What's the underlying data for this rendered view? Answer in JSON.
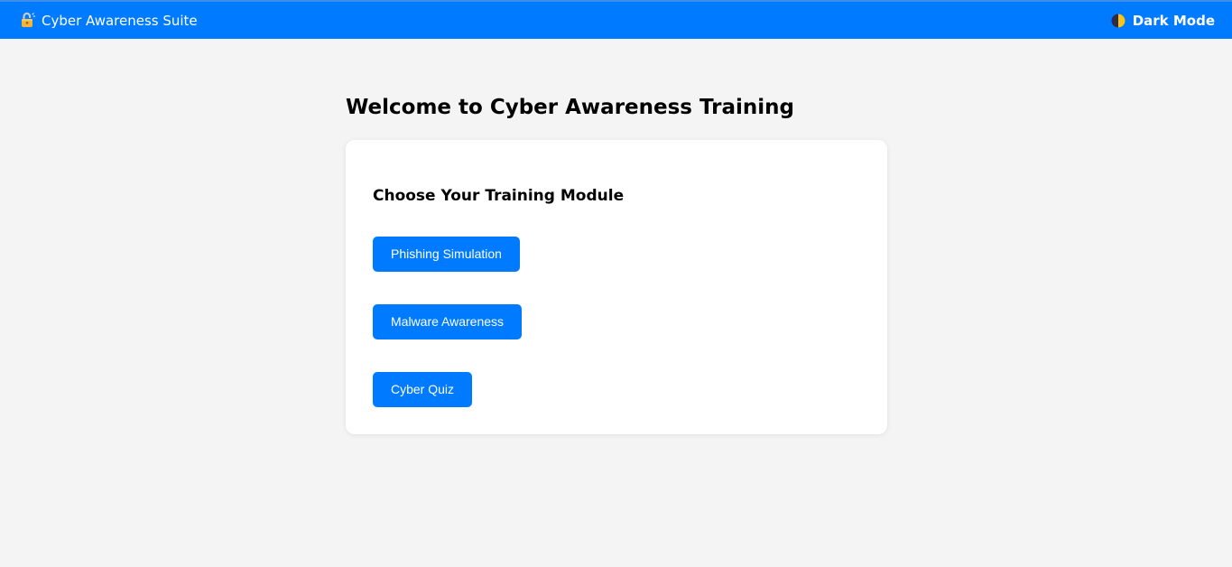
{
  "header": {
    "brand_icon": "lock-icon",
    "brand_title": "Cyber Awareness Suite",
    "dark_mode_icon": "contrast-icon",
    "dark_mode_label": "Dark Mode",
    "accent_color": "#007bff"
  },
  "main": {
    "title": "Welcome to Cyber Awareness Training",
    "card": {
      "heading": "Choose Your Training Module",
      "modules": [
        {
          "label": "Phishing Simulation"
        },
        {
          "label": "Malware Awareness"
        },
        {
          "label": "Cyber Quiz"
        }
      ]
    }
  }
}
